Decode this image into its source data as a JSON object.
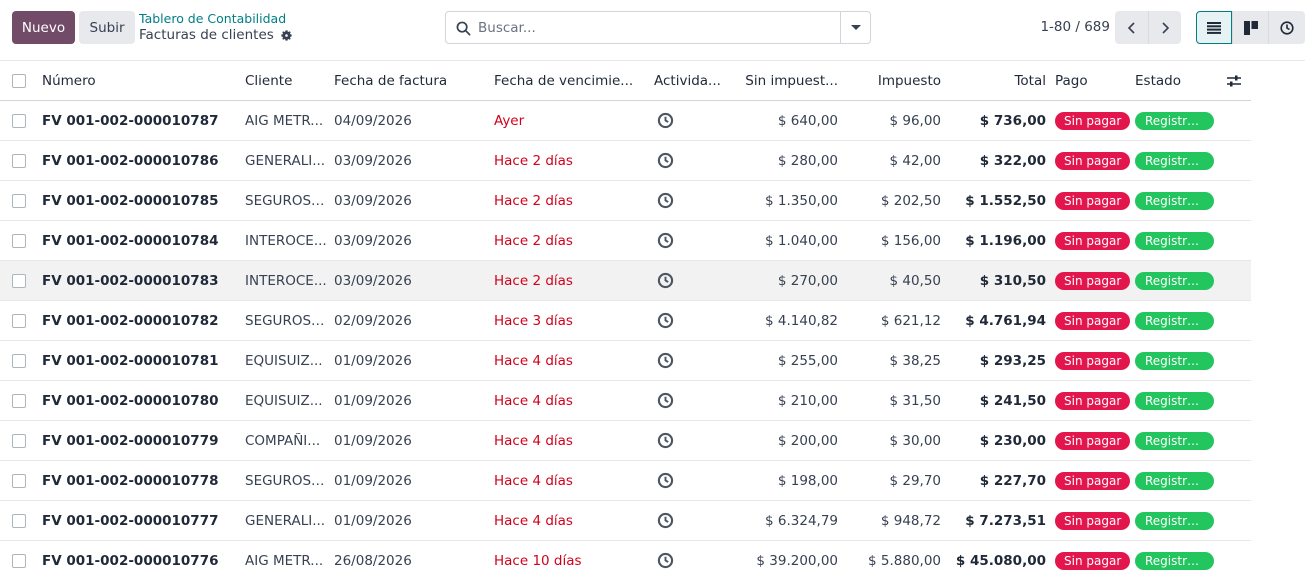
{
  "toolbar": {
    "new_label": "Nuevo",
    "upload_label": "Subir"
  },
  "breadcrumb": {
    "parent": "Tablero de Contabilidad",
    "current": "Facturas de clientes"
  },
  "search": {
    "placeholder": "Buscar..."
  },
  "pager": {
    "value": "1-80 / 689"
  },
  "columns": {
    "numero": "Número",
    "cliente": "Cliente",
    "fecha": "Fecha de factura",
    "vencimiento": "Fecha de vencimie...",
    "actividad": "Activida...",
    "sin_impuestos": "Sin impuest...",
    "impuesto": "Impuesto",
    "total": "Total",
    "pago": "Pago",
    "estado": "Estado"
  },
  "rows": [
    {
      "numero": "FV 001-002-000010787",
      "cliente": "AIG METR...",
      "fecha": "04/09/2026",
      "vencimiento": "Ayer",
      "sin": "$ 640,00",
      "imp": "$ 96,00",
      "total": "$ 736,00",
      "pago": "Sin pagar",
      "estado": "Registra..."
    },
    {
      "numero": "FV 001-002-000010786",
      "cliente": "GENERALI...",
      "fecha": "03/09/2026",
      "vencimiento": "Hace 2 días",
      "sin": "$ 280,00",
      "imp": "$ 42,00",
      "total": "$ 322,00",
      "pago": "Sin pagar",
      "estado": "Registra..."
    },
    {
      "numero": "FV 001-002-000010785",
      "cliente": "SEGUROS ...",
      "fecha": "03/09/2026",
      "vencimiento": "Hace 2 días",
      "sin": "$ 1.350,00",
      "imp": "$ 202,50",
      "total": "$ 1.552,50",
      "pago": "Sin pagar",
      "estado": "Registra..."
    },
    {
      "numero": "FV 001-002-000010784",
      "cliente": "INTEROCE...",
      "fecha": "03/09/2026",
      "vencimiento": "Hace 2 días",
      "sin": "$ 1.040,00",
      "imp": "$ 156,00",
      "total": "$ 1.196,00",
      "pago": "Sin pagar",
      "estado": "Registra..."
    },
    {
      "numero": "FV 001-002-000010783",
      "cliente": "INTEROCE...",
      "fecha": "03/09/2026",
      "vencimiento": "Hace 2 días",
      "sin": "$ 270,00",
      "imp": "$ 40,50",
      "total": "$ 310,50",
      "pago": "Sin pagar",
      "estado": "Registra..."
    },
    {
      "numero": "FV 001-002-000010782",
      "cliente": "SEGUROS ...",
      "fecha": "02/09/2026",
      "vencimiento": "Hace 3 días",
      "sin": "$ 4.140,82",
      "imp": "$ 621,12",
      "total": "$ 4.761,94",
      "pago": "Sin pagar",
      "estado": "Registra..."
    },
    {
      "numero": "FV 001-002-000010781",
      "cliente": "EQUISUIZ...",
      "fecha": "01/09/2026",
      "vencimiento": "Hace 4 días",
      "sin": "$ 255,00",
      "imp": "$ 38,25",
      "total": "$ 293,25",
      "pago": "Sin pagar",
      "estado": "Registra..."
    },
    {
      "numero": "FV 001-002-000010780",
      "cliente": "EQUISUIZ...",
      "fecha": "01/09/2026",
      "vencimiento": "Hace 4 días",
      "sin": "$ 210,00",
      "imp": "$ 31,50",
      "total": "$ 241,50",
      "pago": "Sin pagar",
      "estado": "Registra..."
    },
    {
      "numero": "FV 001-002-000010779",
      "cliente": "COMPAÑI...",
      "fecha": "01/09/2026",
      "vencimiento": "Hace 4 días",
      "sin": "$ 200,00",
      "imp": "$ 30,00",
      "total": "$ 230,00",
      "pago": "Sin pagar",
      "estado": "Registra..."
    },
    {
      "numero": "FV 001-002-000010778",
      "cliente": "SEGUROS ...",
      "fecha": "01/09/2026",
      "vencimiento": "Hace 4 días",
      "sin": "$ 198,00",
      "imp": "$ 29,70",
      "total": "$ 227,70",
      "pago": "Sin pagar",
      "estado": "Registra..."
    },
    {
      "numero": "FV 001-002-000010777",
      "cliente": "GENERALI...",
      "fecha": "01/09/2026",
      "vencimiento": "Hace 4 días",
      "sin": "$ 6.324,79",
      "imp": "$ 948,72",
      "total": "$ 7.273,51",
      "pago": "Sin pagar",
      "estado": "Registra..."
    },
    {
      "numero": "FV 001-002-000010776",
      "cliente": "AIG METR...",
      "fecha": "26/08/2026",
      "vencimiento": "Hace 10 días",
      "sin": "$ 39.200,00",
      "imp": "$ 5.880,00",
      "total": "$ 45.080,00",
      "pago": "Sin pagar",
      "estado": "Registra..."
    }
  ],
  "colors": {
    "brand": "#714b67",
    "link": "#017e84",
    "overdue": "#d0021b",
    "badge_unpaid": "#e2154d",
    "badge_posted": "#22c55e"
  },
  "icons": {
    "settings": "gear-icon",
    "search": "search-icon",
    "activity": "clock-icon",
    "view_list": "list-view-icon",
    "view_kanban": "kanban-view-icon",
    "view_activity": "activity-view-icon",
    "optional_columns": "sliders-icon"
  }
}
